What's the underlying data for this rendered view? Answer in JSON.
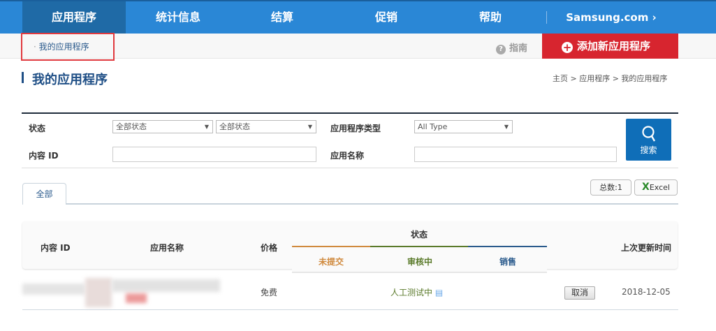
{
  "nav": {
    "items": [
      "应用程序",
      "统计信息",
      "结算",
      "促销",
      "帮助"
    ],
    "samsung": "Samsung.com ›"
  },
  "subbar": {
    "breadcrumb": "我的应用程序",
    "guide": "指南",
    "add_button": "添加新应用程序"
  },
  "page": {
    "title": "我的应用程序",
    "breadcrumb": "主页 > 应用程序 > 我的应用程序"
  },
  "filter": {
    "status_label": "状态",
    "status_select1": "全部状态",
    "status_select2": "全部状态",
    "type_label": "应用程序类型",
    "type_select": "All Type",
    "content_id_label": "内容 ID",
    "app_name_label": "应用名称",
    "search_button": "搜索"
  },
  "tabs": {
    "all": "全部",
    "total": "总数:1",
    "excel": "Excel"
  },
  "table": {
    "headers": {
      "content_id": "内容 ID",
      "app_name": "应用名称",
      "price": "价格",
      "status": "状态",
      "not_submitted": "未提交",
      "reviewing": "审核中",
      "selling": "销售",
      "updated": "上次更新时间"
    },
    "rows": [
      {
        "price": "免费",
        "status": "人工测试中",
        "action": "取消",
        "updated": "2018-12-05"
      }
    ]
  },
  "colors": {
    "nav": "#2a87d6",
    "add": "#d7252f",
    "not_submitted": "#d08a3e",
    "reviewing": "#5a7a2a",
    "selling": "#2a5a8c"
  }
}
